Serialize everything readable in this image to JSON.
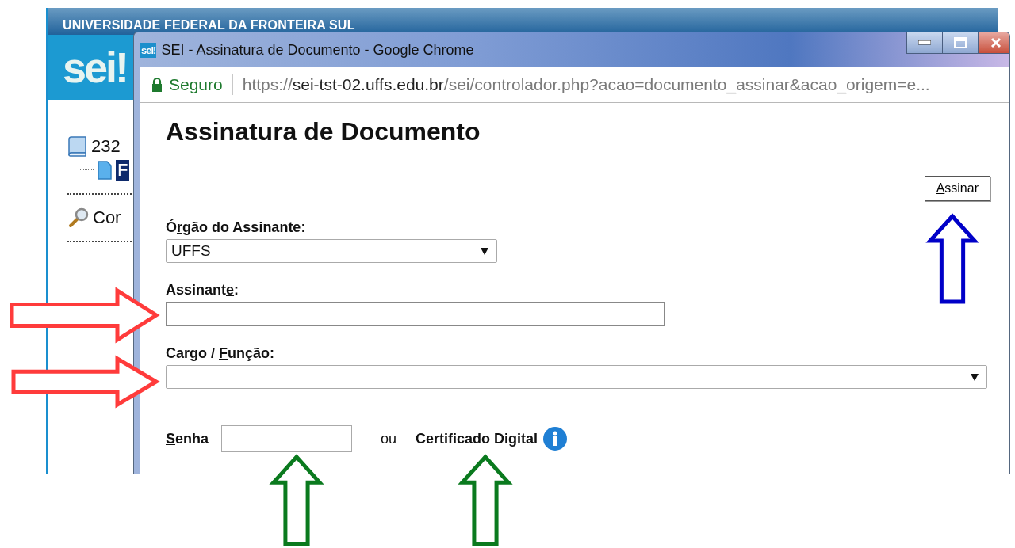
{
  "background_app": {
    "header_title": "UNIVERSIDADE FEDERAL DA FRONTEIRA SUL",
    "logo": "sei!",
    "tree": [
      {
        "label": "232",
        "selected": false,
        "children": [
          {
            "label": "F",
            "selected": true
          }
        ]
      }
    ],
    "menu_items": [
      {
        "label": "Cor"
      }
    ]
  },
  "popup": {
    "icon_text": "sei!",
    "title": "SEI - Assinatura de Documento - Google Chrome",
    "security": "Seguro",
    "url_scheme": "https://",
    "url_host": "sei-tst-02.uffs.edu.br",
    "url_path": "/sei/controlador.php?acao=documento_assinar&acao_origem=e...",
    "heading": "Assinatura de Documento",
    "sign_button": {
      "key": "A",
      "after": "ssinar"
    },
    "fields": [
      {
        "kind": "select",
        "label": {
          "before": "Ó",
          "key": "r",
          "after": "gão do Assinante:"
        },
        "value": "UFFS"
      },
      {
        "kind": "text",
        "label": {
          "before": "Assinant",
          "key": "e",
          "after": ":"
        }
      },
      {
        "kind": "wide-select",
        "label": {
          "before": "Cargo / ",
          "key": "F",
          "after": "unção:"
        }
      }
    ],
    "password": {
      "label": {
        "key": "S",
        "after": "enha"
      },
      "separator": "ou",
      "certificate": "Certificado Digital"
    }
  },
  "annotations": [
    {
      "kind": "arrow-right",
      "color": "#ff3b3b"
    },
    {
      "kind": "arrow-right",
      "color": "#ff3b3b"
    },
    {
      "kind": "arrow-up",
      "color": "#0000c8"
    },
    {
      "kind": "arrow-up",
      "color": "#0a7a1e"
    },
    {
      "kind": "arrow-up",
      "color": "#0a7a1e"
    }
  ]
}
